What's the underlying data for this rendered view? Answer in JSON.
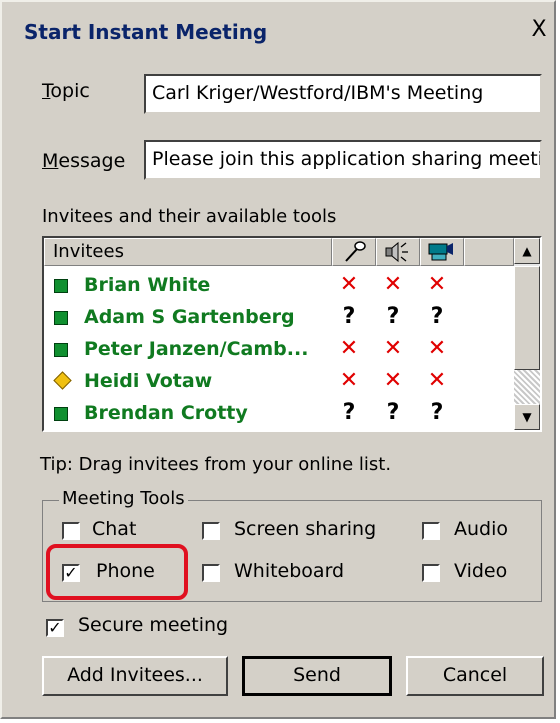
{
  "dialog": {
    "title": "Start Instant Meeting",
    "close_label": "X"
  },
  "form": {
    "topic_label": "Topic",
    "topic_value": "Carl Kriger/Westford/IBM's Meeting",
    "message_label": "Message",
    "message_value": "Please join this application sharing meetir"
  },
  "invitees": {
    "section_label": "Invitees and their available tools",
    "column_header": "Invitees",
    "tool_icons": [
      "microphone-icon",
      "speaker-icon",
      "video-camera-icon"
    ],
    "rows": [
      {
        "status": "online",
        "name": "Brian White",
        "tools": [
          "✕",
          "✕",
          "✕"
        ]
      },
      {
        "status": "online",
        "name": "Adam S Gartenberg",
        "tools": [
          "?",
          "?",
          "?"
        ]
      },
      {
        "status": "online",
        "name": "Peter Janzen/Camb...",
        "tools": [
          "✕",
          "✕",
          "✕"
        ]
      },
      {
        "status": "away",
        "name": "Heidi Votaw",
        "tools": [
          "✕",
          "✕",
          "✕"
        ]
      },
      {
        "status": "online",
        "name": "Brendan Crotty",
        "tools": [
          "?",
          "?",
          "?"
        ]
      }
    ],
    "tip": "Tip: Drag invitees from your online list."
  },
  "meeting_tools": {
    "title": "Meeting Tools",
    "options": [
      {
        "label": "Chat",
        "checked": false
      },
      {
        "label": "Screen sharing",
        "checked": false
      },
      {
        "label": "Audio",
        "checked": false
      },
      {
        "label": "Phone",
        "checked": true
      },
      {
        "label": "Whiteboard",
        "checked": false
      },
      {
        "label": "Video",
        "checked": false
      }
    ]
  },
  "secure": {
    "label": "Secure meeting",
    "checked": true
  },
  "buttons": {
    "add_invitees": "Add Invitees...",
    "send": "Send",
    "cancel": "Cancel"
  },
  "colors": {
    "online": "#109030",
    "away": "#f0c010",
    "unavailable": "#e00000",
    "highlight": "#e01020",
    "title": "#0a246a"
  }
}
